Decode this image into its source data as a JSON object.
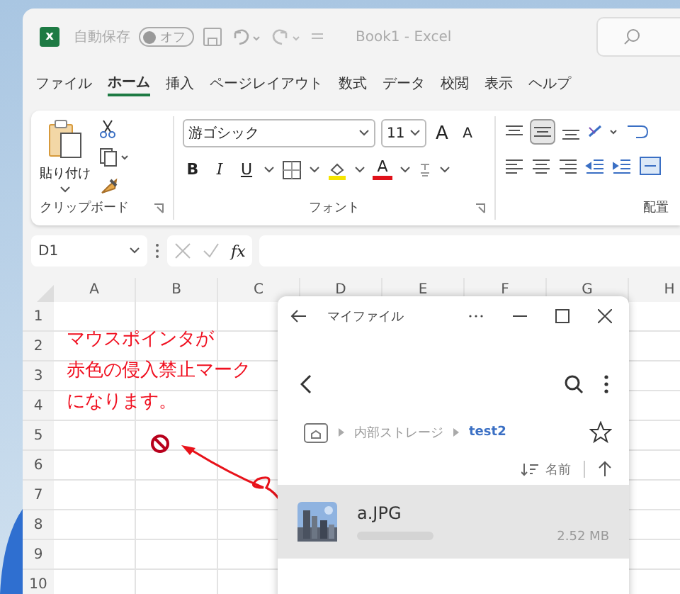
{
  "title_bar": {
    "app_icon": "x",
    "autosave_label": "自動保存",
    "autosave_toggle": {
      "label": "オフ",
      "on": false
    },
    "title": "Book1 - Excel"
  },
  "ribbon_tabs": [
    {
      "label": "ファイル",
      "selected": false
    },
    {
      "label": "ホーム",
      "selected": true
    },
    {
      "label": "挿入",
      "selected": false
    },
    {
      "label": "ページレイアウト",
      "selected": false
    },
    {
      "label": "数式",
      "selected": false
    },
    {
      "label": "データ",
      "selected": false
    },
    {
      "label": "校閲",
      "selected": false
    },
    {
      "label": "表示",
      "selected": false
    },
    {
      "label": "ヘルプ",
      "selected": false
    }
  ],
  "ribbon": {
    "paste_label": "貼り付け",
    "font_name": "游ゴシック",
    "font_size": "11",
    "grow_font": "A",
    "shrink_font": "A",
    "format_buttons": [
      "B",
      "I",
      "U"
    ],
    "font_color_button": "A",
    "group_labels": [
      "クリップボード",
      "フォント",
      "配置"
    ]
  },
  "formula_bar": {
    "name_box": "D1",
    "function_button": "fx"
  },
  "sheet": {
    "columns": [
      "A",
      "B",
      "C",
      "D",
      "E",
      "F",
      "G",
      "H"
    ],
    "rows": [
      "1",
      "2",
      "3",
      "4",
      "5",
      "6",
      "7",
      "8",
      "9",
      "10"
    ]
  },
  "annotation": {
    "lines": [
      "マウスポインタが",
      "赤色の侵入禁止マーク",
      "になります。"
    ]
  },
  "file_window": {
    "title": "マイファイル",
    "breadcrumb": [
      {
        "label": "内部ストレージ",
        "selected": false
      },
      {
        "label": "test2",
        "selected": true
      }
    ],
    "sort_label": "名前",
    "files": [
      {
        "name": "a.JPG",
        "size": "2.52 MB",
        "kind": "picture"
      }
    ]
  }
}
